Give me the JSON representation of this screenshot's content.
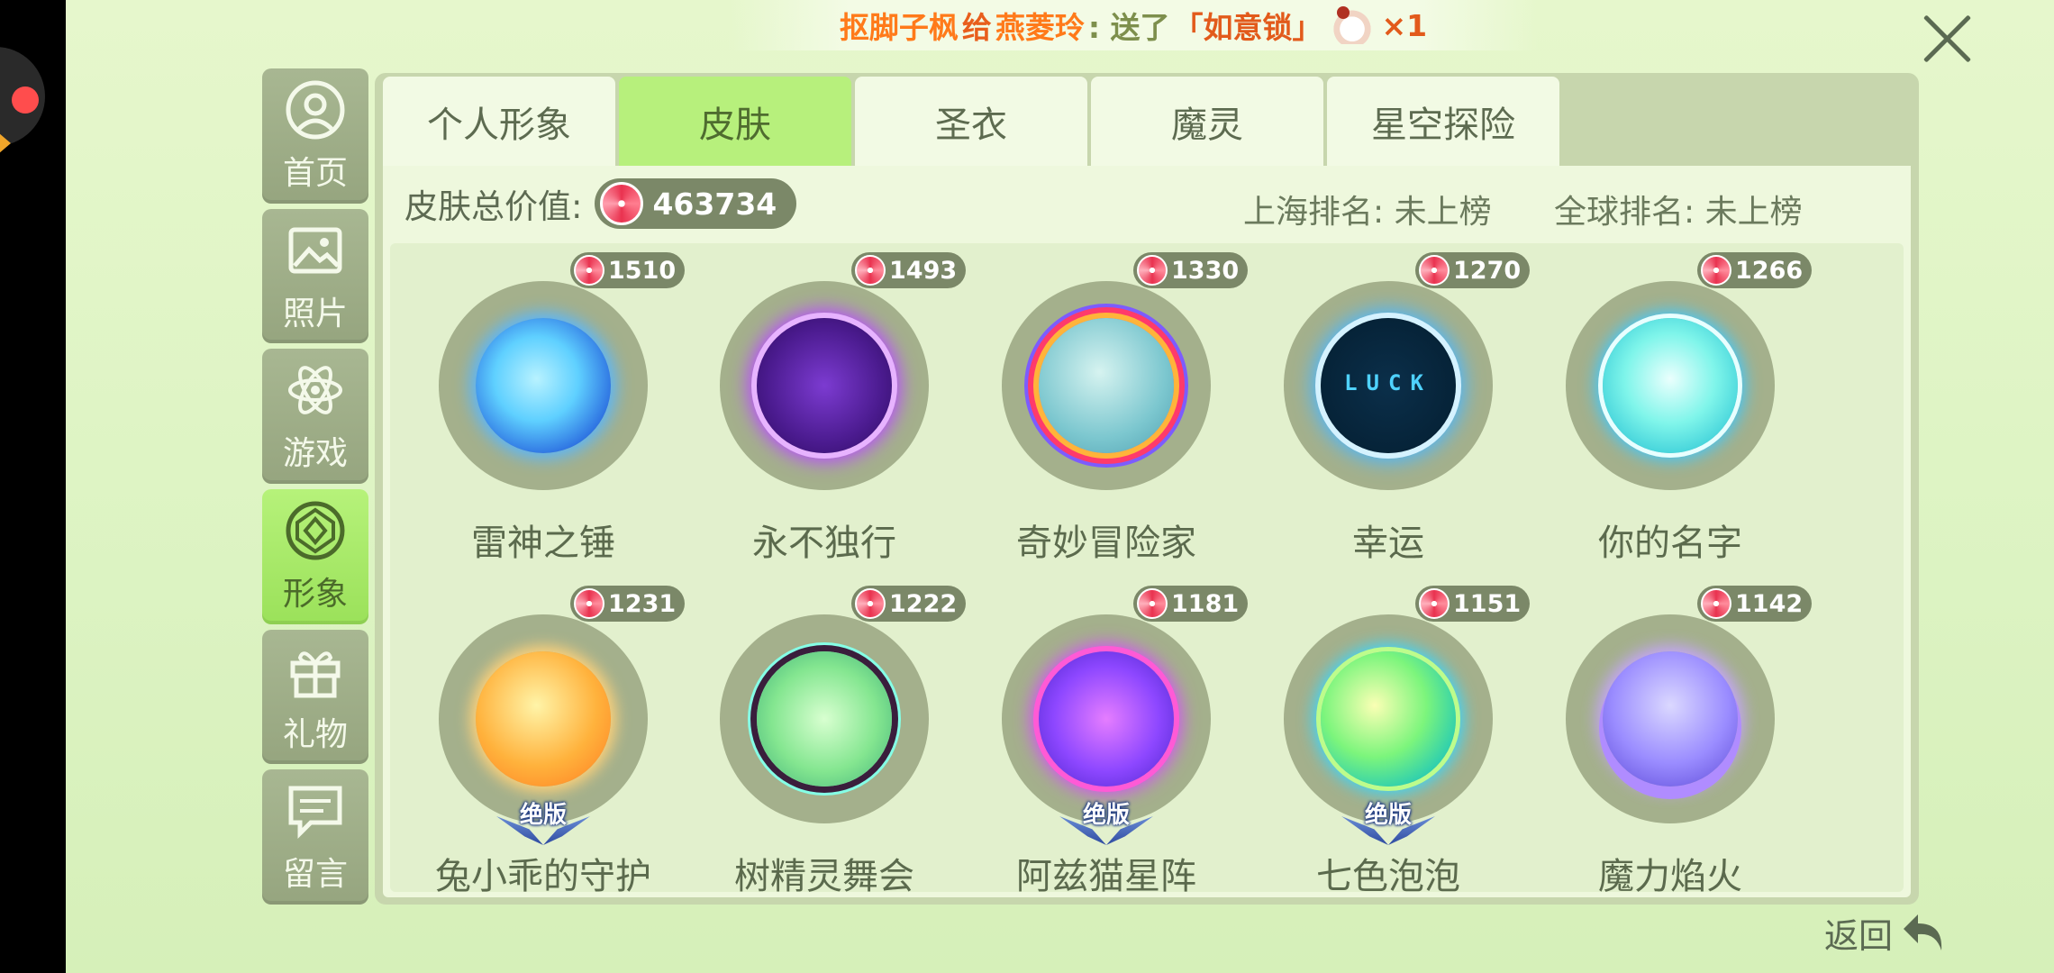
{
  "broadcast": {
    "sender": "抠脚子枫",
    "gives_word": "给",
    "receiver": "燕菱玲",
    "mid": ": 送了",
    "item": "「如意锁」",
    "count": "×1"
  },
  "nav": [
    {
      "label": "首页",
      "icon": "home-icon"
    },
    {
      "label": "照片",
      "icon": "photo-icon"
    },
    {
      "label": "游戏",
      "icon": "atom-icon"
    },
    {
      "label": "形象",
      "icon": "gem-icon"
    },
    {
      "label": "礼物",
      "icon": "gift-icon"
    },
    {
      "label": "留言",
      "icon": "message-icon"
    }
  ],
  "active_nav": "形象",
  "tabs": [
    "个人形象",
    "皮肤",
    "圣衣",
    "魔灵",
    "星空探险"
  ],
  "active_tab": "皮肤",
  "summary": {
    "label": "皮肤总价值:",
    "value": "463734",
    "shanghai_rank": "上海排名: 未上榜",
    "global_rank": "全球排名: 未上榜"
  },
  "skins": [
    {
      "name": "雷神之锤",
      "value": "1510",
      "limited": ""
    },
    {
      "name": "永不独行",
      "value": "1493",
      "limited": ""
    },
    {
      "name": "奇妙冒险家",
      "value": "1330",
      "limited": ""
    },
    {
      "name": "幸运",
      "value": "1270",
      "limited": "",
      "orb_text": "LUCK"
    },
    {
      "name": "你的名字",
      "value": "1266",
      "limited": ""
    },
    {
      "name": "兔小乖的守护",
      "value": "1231",
      "limited": "绝版"
    },
    {
      "name": "树精灵舞会",
      "value": "1222",
      "limited": ""
    },
    {
      "name": "阿兹猫星阵",
      "value": "1181",
      "limited": "绝版"
    },
    {
      "name": "七色泡泡",
      "value": "1151",
      "limited": "绝版"
    },
    {
      "name": "魔力焰火",
      "value": "1142",
      "limited": ""
    }
  ],
  "back_label": "返回",
  "colors": {
    "active": "#b7f07c",
    "panel": "#eef8dd",
    "badge": "#7b8868"
  }
}
